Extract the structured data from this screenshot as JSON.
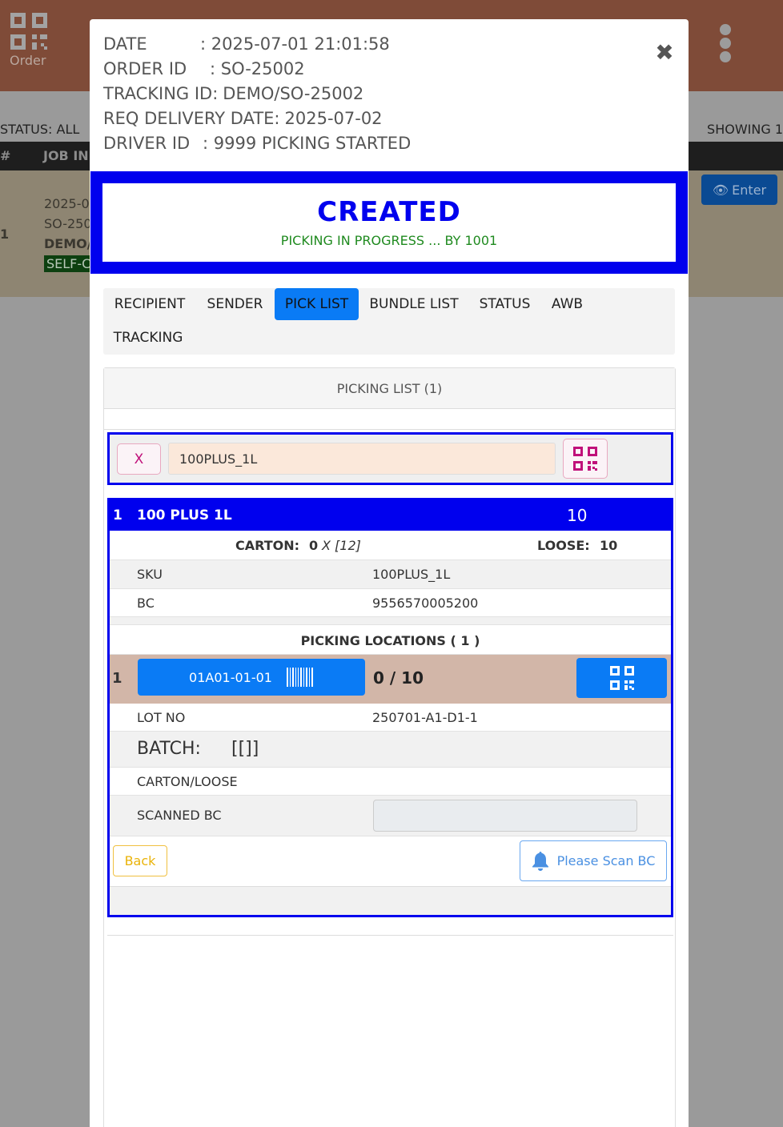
{
  "background": {
    "order_label": "Order",
    "status_text": "STATUS: ALL",
    "showing_text": "SHOWING 1",
    "columns": [
      "#",
      "JOB IN"
    ],
    "row": {
      "index": "1",
      "date": "2025-0",
      "order": "SO-250",
      "tracking": "DEMO/",
      "badge": "SELF-C"
    },
    "enter_label": "Enter"
  },
  "modal": {
    "info": [
      {
        "key": "DATE",
        "value": ": 2025-07-01 21:01:58"
      },
      {
        "key": "ORDER ID",
        "value": ": SO-25002"
      },
      {
        "key": "TRACKING ID:",
        "value": "DEMO/SO-25002"
      },
      {
        "key": "REQ DELIVERY DATE:",
        "value": "2025-07-02"
      },
      {
        "key": "DRIVER ID",
        "value": ": 9999 PICKING STARTED"
      }
    ],
    "status": {
      "title": "CREATED",
      "subtitle": "PICKING IN PROGRESS ... BY 1001"
    },
    "tabs": [
      "RECIPIENT",
      "SENDER",
      "PICK LIST",
      "BUNDLE LIST",
      "STATUS",
      "AWB",
      "TRACKING"
    ],
    "active_tab": "PICK LIST",
    "picklist": {
      "header": "PICKING LIST (1)",
      "clear_label": "X",
      "search_value": "100PLUS_1L",
      "item": {
        "index": "1",
        "name": "100 PLUS 1L",
        "qty": "10",
        "carton_label": "CARTON:",
        "carton_value": "0",
        "carton_multiplier": "X [12]",
        "loose_label": "LOOSE:",
        "loose_value": "10",
        "sku_label": "SKU",
        "sku_value": "100PLUS_1L",
        "bc_label": "BC",
        "bc_value": "9556570005200",
        "locations_header": "PICKING LOCATIONS ( 1 )",
        "location": {
          "index": "1",
          "code": "01A01-01-01",
          "progress": "0 / 10"
        },
        "lot_label": "LOT NO",
        "lot_value": "250701-A1-D1-1",
        "batch_label": "BATCH:",
        "batch_value": "[[]]",
        "carton_loose_label": "CARTON/LOOSE",
        "scanned_bc_label": "SCANNED BC",
        "back_label": "Back",
        "scan_prompt": "Please Scan BC"
      }
    }
  },
  "colors": {
    "header_bg": "#7f4b38",
    "primary_blue": "#0000ee",
    "accent_blue": "#0a7bf5",
    "location_row": "#d2b6a8",
    "magenta": "#c0107a"
  }
}
